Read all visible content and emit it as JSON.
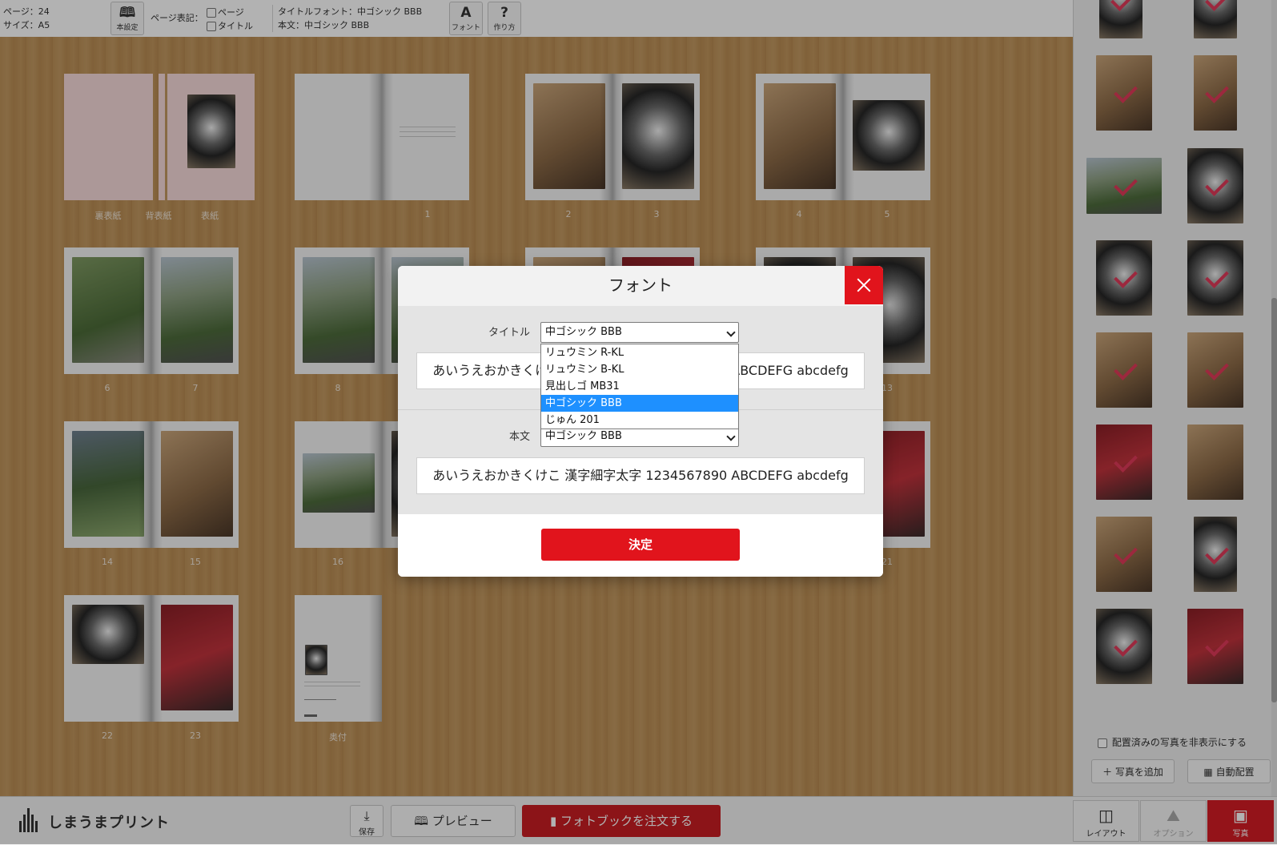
{
  "toolbar": {
    "page_count": "ページ：24",
    "size": "サイズ：A5",
    "book_settings_label": "本設定",
    "page_notation_label": "ページ表記：",
    "page_checkbox_label": "ページ",
    "title_checkbox_label": "タイトル",
    "title_font_info": "タイトルフォント：中ゴシック BBB",
    "body_font_info": "本文：中ゴシック BBB",
    "font_button_label": "フォント",
    "howto_button_label": "作り方"
  },
  "pages": {
    "cover_back": "裏表紙",
    "spine": "背表紙",
    "cover_front": "表紙",
    "p1": "1",
    "p2": "2",
    "p3": "3",
    "p4": "4",
    "p5": "5",
    "p6": "6",
    "p7": "7",
    "p8": "8",
    "p13": "13",
    "p14": "14",
    "p15": "15",
    "p16": "16",
    "p21": "21",
    "p22": "22",
    "p23": "23",
    "colophon": "奥付"
  },
  "right_panel": {
    "hide_placed_label": "配置済みの写真を非表示にする",
    "add_photos_label": "＋ 写真を追加",
    "auto_layout_label": "自動配置"
  },
  "bottom": {
    "logo_text": "しまうまプリント",
    "save_label": "保存",
    "preview_label": "プレビュー",
    "order_label": "フォトブックを注文する",
    "tab_layout": "レイアウト",
    "tab_option": "オプション",
    "tab_photo": "写真"
  },
  "modal": {
    "title": "フォント",
    "title_label": "タイトル",
    "title_selected": "中ゴシック BBB",
    "body_label": "本文",
    "body_selected": "中ゴシック BBB",
    "title_sample": "あいうえおかきくけこ 漢字細字太字 1234567890 ABCDEFG abcdefg",
    "body_sample": "あいうえおかきくけこ 漢字細字太字 1234567890 ABCDEFG abcdefg",
    "confirm_label": "決定",
    "title_options": [
      "リュウミン R-KL",
      "リュウミン B-KL",
      "見出しゴ MB31",
      "中ゴシック BBB",
      "じゅん 201"
    ],
    "selected_index": 3
  },
  "colors": {
    "accent_red": "#e1141c",
    "highlight_blue": "#1e90ff",
    "check_pink": "#e03a5a"
  }
}
